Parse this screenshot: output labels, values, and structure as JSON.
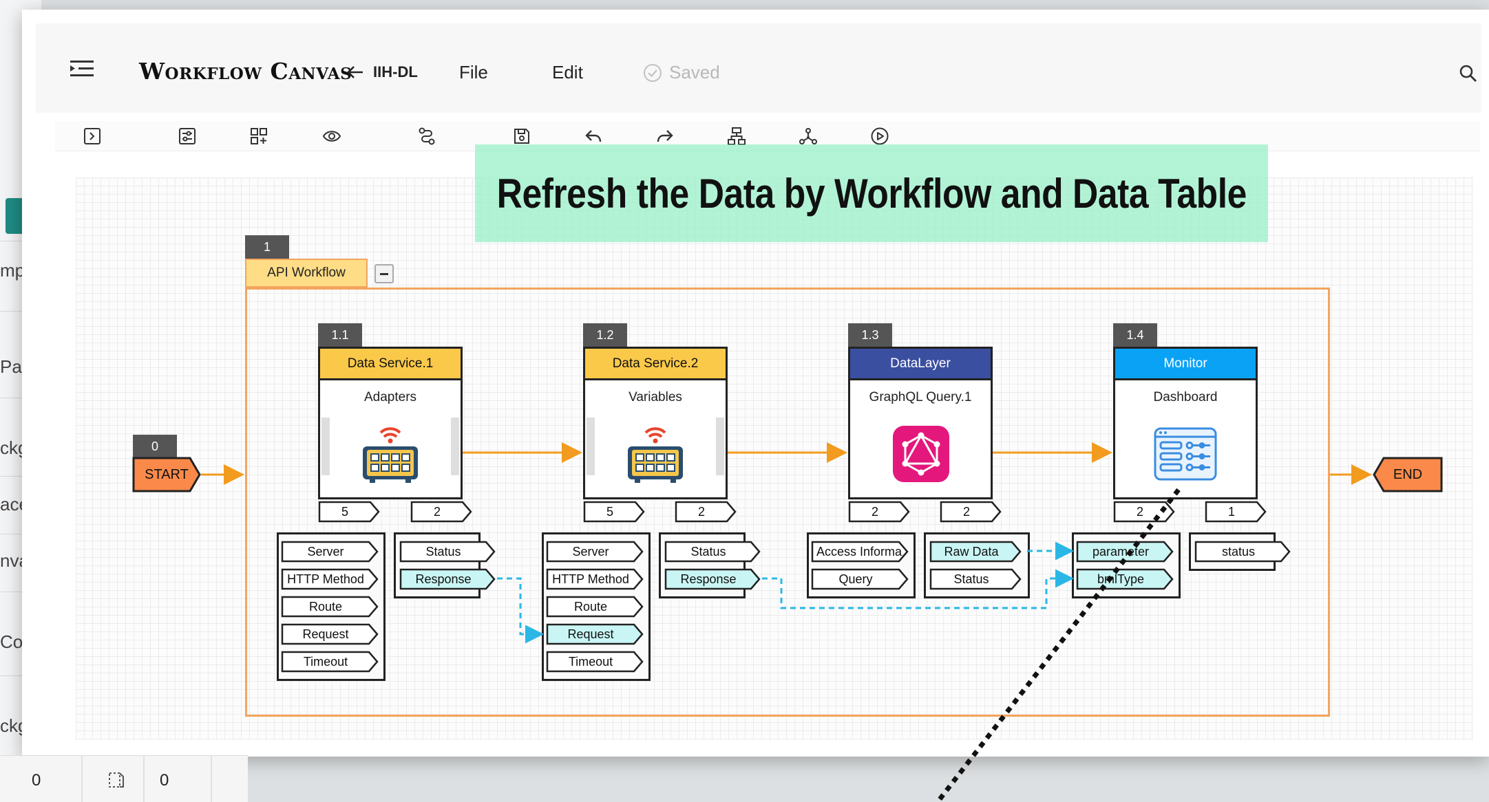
{
  "app": {
    "title": "Workflow Canvas",
    "back_label": "IIH-DL",
    "menu": [
      "File",
      "Edit"
    ],
    "status": "Saved"
  },
  "background_app": {
    "labels": [
      "mp",
      "Pag",
      "ckg",
      "ace",
      "nva",
      "Cor",
      "ckg"
    ],
    "status_values": [
      "0",
      "0"
    ]
  },
  "banner": "Refresh the Data by Workflow and Data Table",
  "group": {
    "number": "1",
    "title": "API Workflow"
  },
  "start": {
    "number": "0",
    "label": "START"
  },
  "end": {
    "label": "END"
  },
  "nodes": [
    {
      "number": "1.1",
      "title": "Data Service.1",
      "subtitle": "Adapters",
      "header_color": "#fbc94a",
      "header_text_color": "#111111",
      "in_count": "5",
      "out_count": "2",
      "inputs": [
        "Server",
        "HTTP Method",
        "Route",
        "Request",
        "Timeout"
      ],
      "outputs": [
        "Status",
        "Response"
      ],
      "highlight": [
        "Response"
      ]
    },
    {
      "number": "1.2",
      "title": "Data Service.2",
      "subtitle": "Variables",
      "header_color": "#fbc94a",
      "header_text_color": "#111111",
      "in_count": "5",
      "out_count": "2",
      "inputs": [
        "Server",
        "HTTP Method",
        "Route",
        "Request",
        "Timeout"
      ],
      "outputs": [
        "Status",
        "Response"
      ],
      "highlight": [
        "Request",
        "Response"
      ]
    },
    {
      "number": "1.3",
      "title": "DataLayer",
      "subtitle": "GraphQL Query.1",
      "header_color": "#3b4fa0",
      "header_text_color": "#ffffff",
      "in_count": "2",
      "out_count": "2",
      "inputs": [
        "Access Informa...",
        "Query"
      ],
      "outputs": [
        "Raw Data",
        "Status"
      ],
      "highlight": [
        "Raw Data"
      ]
    },
    {
      "number": "1.4",
      "title": "Monitor",
      "subtitle": "Dashboard",
      "header_color": "#0aa2f5",
      "header_text_color": "#ffffff",
      "in_count": "2",
      "out_count": "1",
      "inputs": [
        "parameter",
        "bmlType"
      ],
      "outputs": [
        "status"
      ],
      "highlight": [
        "parameter",
        "bmlType"
      ]
    }
  ],
  "colors": {
    "flow_arrow": "#f29b1e",
    "data_link": "#2bb7e6",
    "port_highlight": "#c9f6f4",
    "group_border": "#f4a45e",
    "start_end_fill": "#fb8a4a"
  },
  "icons": {
    "node_1_1": "control-panel-icon",
    "node_1_2": "control-panel-icon",
    "node_1_3": "graphql-icon",
    "node_1_4": "dashboard-icon"
  }
}
